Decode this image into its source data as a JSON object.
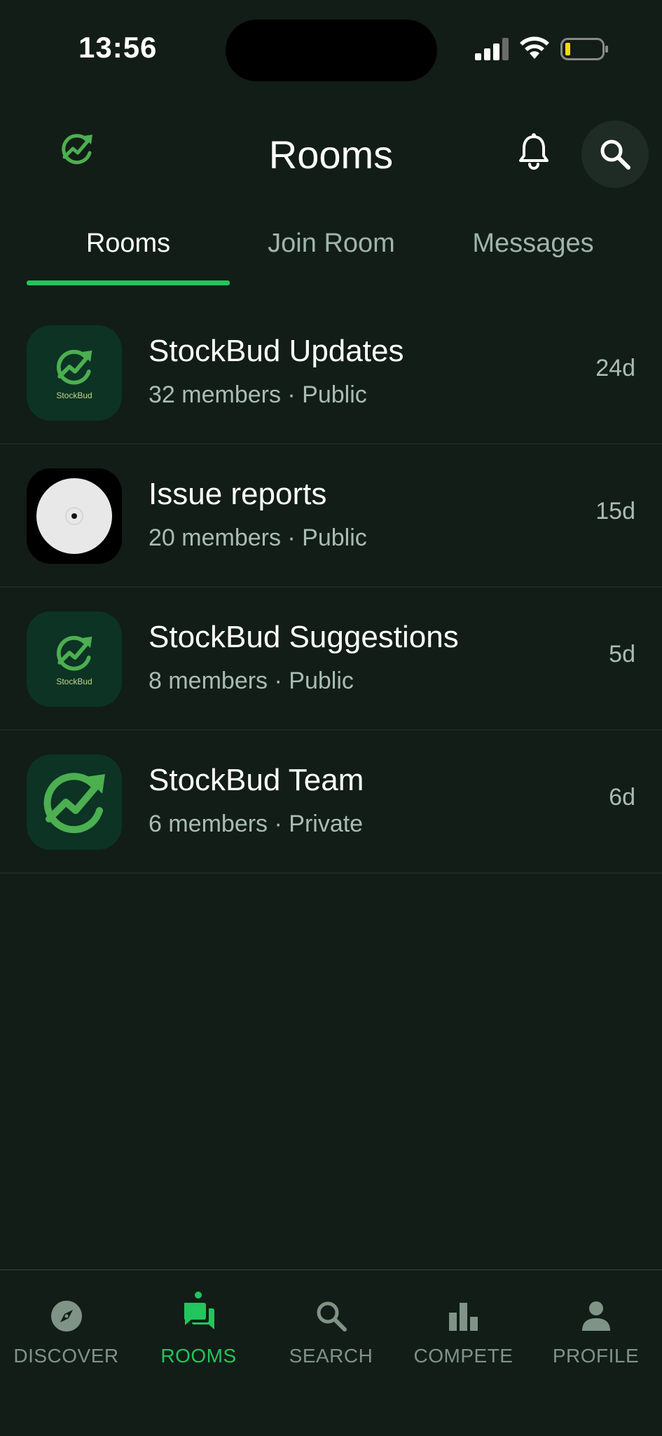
{
  "status_bar": {
    "time": "13:56"
  },
  "header": {
    "title": "Rooms"
  },
  "tabs": [
    {
      "label": "Rooms",
      "active": true
    },
    {
      "label": "Join Room",
      "active": false
    },
    {
      "label": "Messages",
      "active": false
    }
  ],
  "rooms": [
    {
      "name": "StockBud Updates",
      "meta": "32 members · Public",
      "time": "24d",
      "avatar_text": "StockBud",
      "avatar": "stockbud-logo"
    },
    {
      "name": "Issue reports",
      "meta": "20 members · Public",
      "time": "15d",
      "avatar": "white-disc"
    },
    {
      "name": "StockBud Suggestions",
      "meta": "8 members · Public",
      "time": "5d",
      "avatar_text": "StockBud",
      "avatar": "stockbud-logo"
    },
    {
      "name": "StockBud Team",
      "meta": "6 members · Private",
      "time": "6d",
      "avatar": "stockbud-logo-large"
    }
  ],
  "bottom_nav": [
    {
      "label": "DISCOVER",
      "icon": "compass-icon",
      "active": false
    },
    {
      "label": "ROOMS",
      "icon": "chat-icon",
      "active": true
    },
    {
      "label": "SEARCH",
      "icon": "search-icon",
      "active": false
    },
    {
      "label": "COMPETE",
      "icon": "bar-chart-icon",
      "active": false
    },
    {
      "label": "PROFILE",
      "icon": "person-icon",
      "active": false
    }
  ],
  "colors": {
    "accent": "#22c55e",
    "background": "#121d17",
    "avatar_bg": "#0c3324"
  }
}
